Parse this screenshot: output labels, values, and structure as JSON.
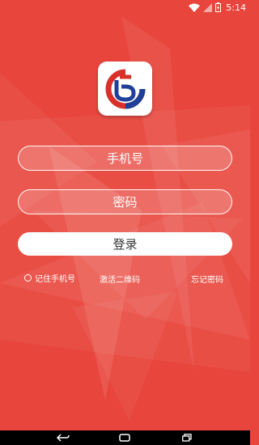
{
  "status_bar": {
    "time": "5:14",
    "icons": [
      "wifi-icon",
      "cell-signal-icon",
      "battery-icon"
    ]
  },
  "logo": {
    "icon": "app-logo-icon",
    "colors": {
      "red": "#d9302a",
      "blue": "#1f3f98"
    }
  },
  "login_form": {
    "phone_placeholder": "手机号",
    "password_placeholder": "密码",
    "login_label": "登录",
    "remember_label": "记住手机号",
    "activate_label": "激活二维码",
    "forgot_label": "忘记密码"
  },
  "nav_bar": {
    "icons": [
      "back-icon",
      "home-icon",
      "recents-icon"
    ]
  },
  "theme": {
    "background": "#e8453c",
    "text": "#ffffff",
    "button_bg": "#ffffff"
  }
}
